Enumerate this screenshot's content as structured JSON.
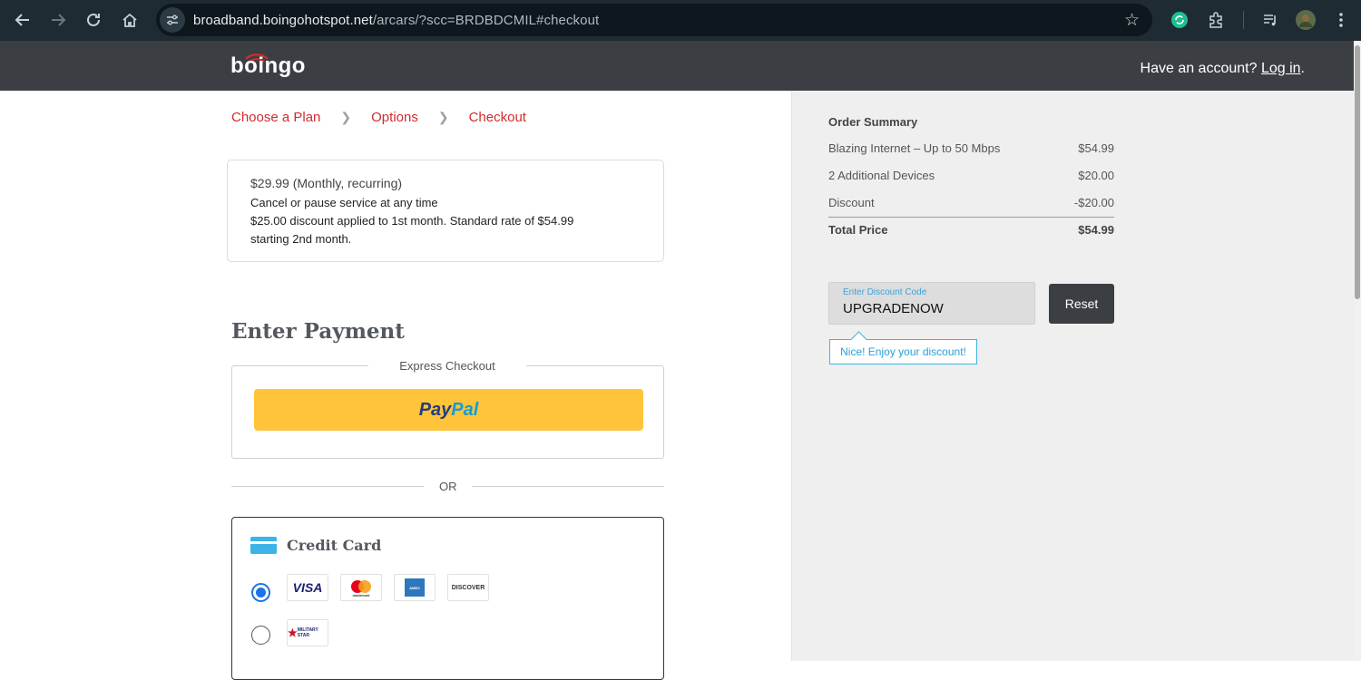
{
  "browser": {
    "url_host": "broadband.boingohotspot.net",
    "url_path": "/arcars/?scc=BRDBDCMIL#checkout",
    "icons": [
      "back-icon",
      "forward-icon",
      "reload-icon",
      "home-icon",
      "site-settings-icon",
      "bookmark-star-icon",
      "extension-icon",
      "puzzle-icon",
      "media-icon",
      "profile-avatar",
      "menu-icon"
    ]
  },
  "header": {
    "logo": "boingo",
    "account_prompt": "Have an account?",
    "login_link": "Log in",
    "login_suffix": "."
  },
  "breadcrumb": {
    "items": [
      {
        "label": "Choose a Plan"
      },
      {
        "label": "Options"
      },
      {
        "label": "Checkout"
      }
    ]
  },
  "plan": {
    "price": "$29.99 (Monthly, recurring)",
    "line1": "Cancel or pause service at any time",
    "line2": "$25.00 discount applied to 1st month. Standard rate of $54.99",
    "line3": "starting 2nd month."
  },
  "payment": {
    "title": "Enter Payment",
    "express_legend": "Express Checkout",
    "paypal_pay": "Pay",
    "paypal_pal": "Pal",
    "or_label": "OR",
    "credit_card_title": "Credit Card",
    "card_logos": [
      "VISA",
      "mastercard",
      "AMEX",
      "DISCOVER",
      "MILITARY STAR"
    ]
  },
  "summary": {
    "title": "Order Summary",
    "items": [
      {
        "label": "Blazing Internet – Up to 50 Mbps",
        "value": "$54.99"
      },
      {
        "label": "2 Additional Devices",
        "value": "$20.00"
      },
      {
        "label": "Discount",
        "value": "-$20.00"
      }
    ],
    "total_label": "Total Price",
    "total_value": "$54.99"
  },
  "discount": {
    "field_label": "Enter Discount Code",
    "field_value": "UPGRADENOW",
    "reset_label": "Reset",
    "success_message": "Nice! Enjoy your discount!"
  },
  "colors": {
    "accent_red": "#d12c2f",
    "header_bg": "#3b3f44",
    "paypal_yellow": "#ffc439",
    "info_blue": "#3cb4e5"
  }
}
